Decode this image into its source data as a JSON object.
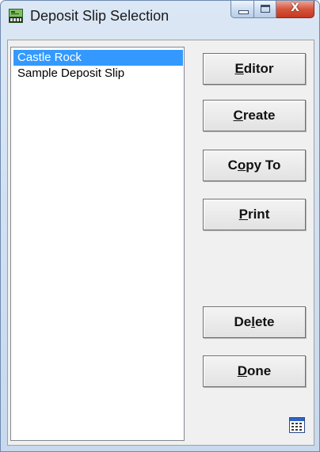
{
  "window": {
    "title": "Deposit Slip Selection",
    "icon": "deposit-slip-app-icon",
    "caption_buttons": [
      "minimize",
      "maximize",
      "close"
    ],
    "close_glyph": "X"
  },
  "list": {
    "items": [
      {
        "label": "Castle Rock",
        "selected": true
      },
      {
        "label": "Sample Deposit Slip",
        "selected": false
      }
    ]
  },
  "buttons": {
    "editor": {
      "mnemonic": "E",
      "rest": "ditor"
    },
    "create": {
      "mnemonic": "C",
      "rest": "reate"
    },
    "copy_to": {
      "pre": "C",
      "mnemonic": "o",
      "rest": "py To"
    },
    "print": {
      "mnemonic": "P",
      "rest": "rint"
    },
    "delete": {
      "pre": "De",
      "mnemonic": "l",
      "rest": "ete"
    },
    "done": {
      "mnemonic": "D",
      "rest": "one"
    }
  },
  "corner_icon": "calendar-grid-icon",
  "colors": {
    "selection": "#3399ff",
    "close_button": "#c4371f",
    "frame": "#cfdff1"
  }
}
